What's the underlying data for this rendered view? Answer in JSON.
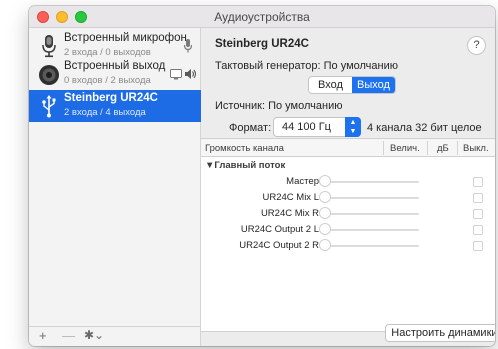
{
  "window": {
    "title": "Аудиоустройства"
  },
  "sidebar": {
    "devices": [
      {
        "name": "Встроенный микрофон",
        "channels": "2 входа / 0 выходов",
        "icon": "microphone-icon",
        "side_icons": [
          "mic-level-icon"
        ]
      },
      {
        "name": "Встроенный выход",
        "channels": "0 входов / 2 выхода",
        "icon": "speaker-icon",
        "side_icons": [
          "display-icon",
          "volume-icon"
        ]
      },
      {
        "name": "Steinberg UR24C",
        "channels": "2 входа / 4 выхода",
        "icon": "usb-icon",
        "selected": true
      }
    ],
    "footer": {
      "add_label": "+",
      "remove_label": "—",
      "settings_label": "✱⌄"
    }
  },
  "main": {
    "device_title": "Steinberg UR24C",
    "help_label": "?",
    "clock_label": "Тактовый генератор:",
    "clock_value": "По умолчанию",
    "tabs": [
      {
        "label": "Вход",
        "active": false
      },
      {
        "label": "Выход",
        "active": true
      }
    ],
    "source_label": "Источник:",
    "source_value": "По умолчанию",
    "format_label": "Формат:",
    "format_value": "44 100 Гц",
    "format_desc": "4 канала 32 бит целое",
    "table": {
      "columns": [
        "Громкость канала",
        "Велич.",
        "дБ",
        "Выкл."
      ],
      "group": "▼Главный поток",
      "rows": [
        "Мастер",
        "UR24C Mix L",
        "UR24C Mix R",
        "UR24C Output 2 L",
        "UR24C Output 2 R"
      ]
    },
    "configure_button": "Настроить динамики..."
  },
  "colors": {
    "accent": "#1d72f0",
    "selected_row": "#1d6ce6"
  }
}
